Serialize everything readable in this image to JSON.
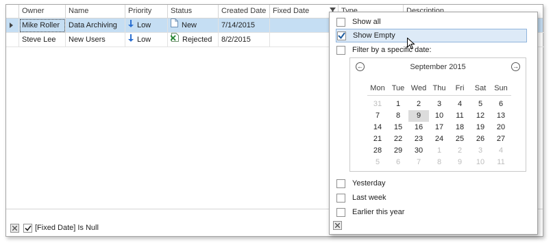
{
  "columns": [
    {
      "label": "Owner"
    },
    {
      "label": "Name"
    },
    {
      "label": "Priority"
    },
    {
      "label": "Status"
    },
    {
      "label": "Created Date"
    },
    {
      "label": "Fixed Date"
    },
    {
      "label": "Type"
    },
    {
      "label": "Description"
    }
  ],
  "rows": [
    {
      "owner": "Mike Roller",
      "name": "Data Archiving",
      "priority": "Low",
      "status": "New",
      "created": "7/14/2015",
      "fixed": "",
      "status_icon": "document-icon",
      "priority_icon": "down-arrow-icon"
    },
    {
      "owner": "Steve Lee",
      "name": "New Users",
      "priority": "Low",
      "status": "Rejected",
      "created": "8/2/2015",
      "fixed": "",
      "status_icon": "rejected-icon",
      "priority_icon": "down-arrow-icon"
    }
  ],
  "filter_bar": {
    "text": "[Fixed Date] Is Null",
    "checked": true
  },
  "popup": {
    "show_all": {
      "label": "Show all",
      "checked": false
    },
    "show_empty": {
      "label": "Show Empty",
      "checked": true
    },
    "specific_date": {
      "label": "Filter by a specific date:",
      "checked": false
    },
    "yesterday": {
      "label": "Yesterday",
      "checked": false
    },
    "last_week": {
      "label": "Last week",
      "checked": false
    },
    "earlier_year": {
      "label": "Earlier this year",
      "checked": false
    }
  },
  "calendar": {
    "month_label": "September 2015",
    "days_of_week": [
      "Mon",
      "Tue",
      "Wed",
      "Thu",
      "Fri",
      "Sat",
      "Sun"
    ],
    "weeks": [
      [
        {
          "d": "31",
          "o": true
        },
        {
          "d": "1"
        },
        {
          "d": "2"
        },
        {
          "d": "3"
        },
        {
          "d": "4"
        },
        {
          "d": "5"
        },
        {
          "d": "6"
        }
      ],
      [
        {
          "d": "7"
        },
        {
          "d": "8"
        },
        {
          "d": "9",
          "t": true
        },
        {
          "d": "10"
        },
        {
          "d": "11"
        },
        {
          "d": "12"
        },
        {
          "d": "13"
        }
      ],
      [
        {
          "d": "14"
        },
        {
          "d": "15"
        },
        {
          "d": "16"
        },
        {
          "d": "17"
        },
        {
          "d": "18"
        },
        {
          "d": "19"
        },
        {
          "d": "20"
        }
      ],
      [
        {
          "d": "21"
        },
        {
          "d": "22"
        },
        {
          "d": "23"
        },
        {
          "d": "24"
        },
        {
          "d": "25"
        },
        {
          "d": "26"
        },
        {
          "d": "27"
        }
      ],
      [
        {
          "d": "28"
        },
        {
          "d": "29"
        },
        {
          "d": "30"
        },
        {
          "d": "1",
          "o": true
        },
        {
          "d": "2",
          "o": true
        },
        {
          "d": "3",
          "o": true
        },
        {
          "d": "4",
          "o": true
        }
      ],
      [
        {
          "d": "5",
          "o": true
        },
        {
          "d": "6",
          "o": true
        },
        {
          "d": "7",
          "o": true
        },
        {
          "d": "8",
          "o": true
        },
        {
          "d": "9",
          "o": true
        },
        {
          "d": "10",
          "o": true
        },
        {
          "d": "11",
          "o": true
        }
      ]
    ]
  },
  "colors": {
    "selection": "#c5def3",
    "hover_item": "#ddeaf7",
    "priority_arrow": "#2a6fd1",
    "rejected_icon": "#2e8b3a"
  }
}
